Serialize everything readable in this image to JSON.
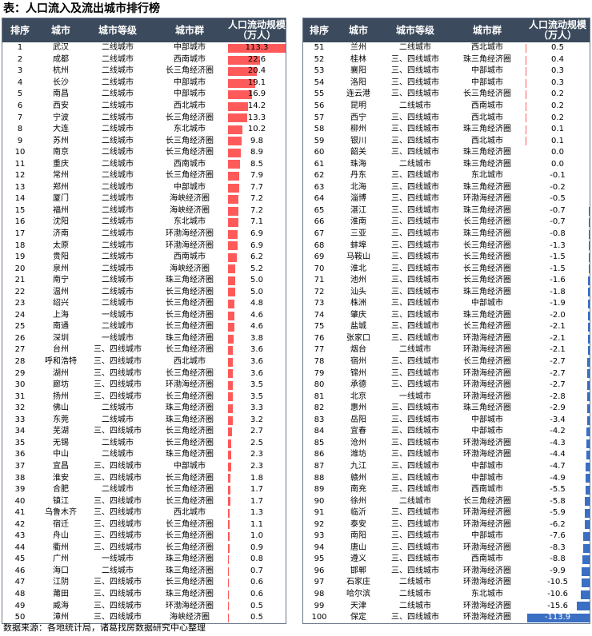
{
  "title": "表：人口流入及流出城市排行榜",
  "source": "数据来源：各地统计局，诸葛找房数据研究中心整理",
  "headers": [
    "排序",
    "城市",
    "城市等级",
    "城市群",
    "人口流动规模\n（万人）"
  ],
  "colors": {
    "header_bg": "#3b4a5c",
    "positive_bar": "#ff5a5a",
    "negative_bar": "#3a6fc4"
  },
  "rows": [
    [
      "1",
      "武汉",
      "二线城市",
      "中部城市",
      "113.3"
    ],
    [
      "2",
      "成都",
      "二线城市",
      "西南城市",
      "22.6"
    ],
    [
      "3",
      "杭州",
      "二线城市",
      "长三角经济圈",
      "20.4"
    ],
    [
      "4",
      "长沙",
      "二线城市",
      "中部城市",
      "19.1"
    ],
    [
      "5",
      "南昌",
      "二线城市",
      "中部城市",
      "16.9"
    ],
    [
      "6",
      "西安",
      "二线城市",
      "西北城市",
      "14.2"
    ],
    [
      "7",
      "宁波",
      "二线城市",
      "长三角经济圈",
      "13.3"
    ],
    [
      "8",
      "大连",
      "二线城市",
      "东北城市",
      "10.2"
    ],
    [
      "9",
      "苏州",
      "二线城市",
      "长三角经济圈",
      "9.8"
    ],
    [
      "10",
      "南京",
      "二线城市",
      "长三角经济圈",
      "8.9"
    ],
    [
      "11",
      "重庆",
      "二线城市",
      "西南城市",
      "8.5"
    ],
    [
      "12",
      "常州",
      "二线城市",
      "长三角经济圈",
      "7.9"
    ],
    [
      "13",
      "郑州",
      "二线城市",
      "中部城市",
      "7.7"
    ],
    [
      "14",
      "厦门",
      "二线城市",
      "海峡经济圈",
      "7.2"
    ],
    [
      "15",
      "福州",
      "二线城市",
      "海峡经济圈",
      "7.2"
    ],
    [
      "16",
      "沈阳",
      "二线城市",
      "东北城市",
      "7.1"
    ],
    [
      "17",
      "济南",
      "二线城市",
      "环渤海经济圈",
      "6.9"
    ],
    [
      "18",
      "太原",
      "二线城市",
      "环渤海经济圈",
      "6.9"
    ],
    [
      "19",
      "贵阳",
      "二线城市",
      "西南城市",
      "6.2"
    ],
    [
      "20",
      "泉州",
      "二线城市",
      "海峡经济圈",
      "5.2"
    ],
    [
      "21",
      "南宁",
      "二线城市",
      "珠三角经济圈",
      "5.0"
    ],
    [
      "22",
      "温州",
      "二线城市",
      "长三角经济圈",
      "5.0"
    ],
    [
      "23",
      "绍兴",
      "二线城市",
      "长三角经济圈",
      "4.8"
    ],
    [
      "24",
      "上海",
      "一线城市",
      "长三角经济圈",
      "4.6"
    ],
    [
      "25",
      "南通",
      "二线城市",
      "长三角经济圈",
      "4.6"
    ],
    [
      "26",
      "深圳",
      "一线城市",
      "珠三角经济圈",
      "3.8"
    ],
    [
      "27",
      "台州",
      "三、四线城市",
      "长三角经济圈",
      "3.6"
    ],
    [
      "28",
      "呼和浩特",
      "三、四线城市",
      "西北城市",
      "3.6"
    ],
    [
      "29",
      "湖州",
      "三、四线城市",
      "长三角经济圈",
      "3.6"
    ],
    [
      "30",
      "廊坊",
      "三、四线城市",
      "环渤海经济圈",
      "3.5"
    ],
    [
      "31",
      "扬州",
      "三、四线城市",
      "长三角经济圈",
      "3.5"
    ],
    [
      "32",
      "佛山",
      "二线城市",
      "珠三角经济圈",
      "3.3"
    ],
    [
      "33",
      "东莞",
      "二线城市",
      "珠三角经济圈",
      "3.2"
    ],
    [
      "34",
      "芜湖",
      "三、四线城市",
      "长三角经济圈",
      "2.7"
    ],
    [
      "35",
      "无锡",
      "二线城市",
      "长三角经济圈",
      "2.5"
    ],
    [
      "36",
      "中山",
      "二线城市",
      "珠三角经济圈",
      "2.3"
    ],
    [
      "37",
      "宜昌",
      "三、四线城市",
      "中部城市",
      "2.3"
    ],
    [
      "38",
      "淮安",
      "三、四线城市",
      "长三角经济圈",
      "1.8"
    ],
    [
      "39",
      "合肥",
      "二线城市",
      "长三角经济圈",
      "1.7"
    ],
    [
      "40",
      "镇江",
      "三、四线城市",
      "长三角经济圈",
      "1.7"
    ],
    [
      "41",
      "乌鲁木齐",
      "三、四线城市",
      "西北城市",
      "1.3"
    ],
    [
      "42",
      "宿迁",
      "三、四线城市",
      "长三角经济圈",
      "1.1"
    ],
    [
      "43",
      "舟山",
      "三、四线城市",
      "长三角经济圈",
      "1.0"
    ],
    [
      "44",
      "衢州",
      "三、四线城市",
      "长三角经济圈",
      "0.9"
    ],
    [
      "45",
      "广州",
      "一线城市",
      "珠三角经济圈",
      "0.8"
    ],
    [
      "46",
      "海口",
      "二线城市",
      "珠三角经济圈",
      "0.7"
    ],
    [
      "47",
      "江阴",
      "三、四线城市",
      "长三角经济圈",
      "0.6"
    ],
    [
      "48",
      "莆田",
      "三、四线城市",
      "珠三角经济圈",
      "0.6"
    ],
    [
      "49",
      "威海",
      "三、四线城市",
      "环渤海经济圈",
      "0.5"
    ],
    [
      "50",
      "漳州",
      "三、四线城市",
      "海峡经济圈",
      "0.5"
    ],
    [
      "51",
      "兰州",
      "二线城市",
      "西北城市",
      "0.5"
    ],
    [
      "52",
      "桂林",
      "三、四线城市",
      "珠三角经济圈",
      "0.4"
    ],
    [
      "53",
      "襄阳",
      "三、四线城市",
      "中部城市",
      "0.3"
    ],
    [
      "54",
      "洛阳",
      "三、四线城市",
      "中部城市",
      "0.3"
    ],
    [
      "55",
      "连云港",
      "三、四线城市",
      "长三角经济圈",
      "0.2"
    ],
    [
      "56",
      "昆明",
      "二线城市",
      "西南城市",
      "0.2"
    ],
    [
      "57",
      "西宁",
      "三、四线城市",
      "西北城市",
      "0.2"
    ],
    [
      "58",
      "柳州",
      "三、四线城市",
      "珠三角经济圈",
      "0.1"
    ],
    [
      "59",
      "银川",
      "三、四线城市",
      "西北城市",
      "0.1"
    ],
    [
      "60",
      "韶关",
      "三、四线城市",
      "珠三角经济圈",
      "0.0"
    ],
    [
      "61",
      "珠海",
      "二线城市",
      "珠三角经济圈",
      "0.0"
    ],
    [
      "62",
      "丹东",
      "三、四线城市",
      "东北城市",
      "-0.1"
    ],
    [
      "63",
      "北海",
      "三、四线城市",
      "珠三角经济圈",
      "-0.2"
    ],
    [
      "64",
      "淄博",
      "三、四线城市",
      "环渤海经济圈",
      "-0.5"
    ],
    [
      "65",
      "湛江",
      "三、四线城市",
      "珠三角经济圈",
      "-0.7"
    ],
    [
      "66",
      "淮南",
      "三、四线城市",
      "长三角经济圈",
      "-0.7"
    ],
    [
      "67",
      "三亚",
      "三、四线城市",
      "珠三角经济圈",
      "-0.8"
    ],
    [
      "68",
      "蚌埠",
      "三、四线城市",
      "长三角经济圈",
      "-1.3"
    ],
    [
      "69",
      "马鞍山",
      "三、四线城市",
      "长三角经济圈",
      "-1.5"
    ],
    [
      "70",
      "淮北",
      "三、四线城市",
      "长三角经济圈",
      "-1.5"
    ],
    [
      "71",
      "池州",
      "三、四线城市",
      "长三角经济圈",
      "-1.6"
    ],
    [
      "72",
      "汕头",
      "三、四线城市",
      "珠三角经济圈",
      "-1.8"
    ],
    [
      "73",
      "株洲",
      "三、四线城市",
      "中部城市",
      "-1.9"
    ],
    [
      "74",
      "肇庆",
      "三、四线城市",
      "珠三角经济圈",
      "-2.0"
    ],
    [
      "75",
      "盐城",
      "三、四线城市",
      "长三角经济圈",
      "-2.1"
    ],
    [
      "76",
      "张家口",
      "三、四线城市",
      "环渤海经济圈",
      "-2.1"
    ],
    [
      "77",
      "烟台",
      "二线城市",
      "环渤海经济圈",
      "-2.1"
    ],
    [
      "78",
      "宿州",
      "三、四线城市",
      "长三角经济圈",
      "-2.7"
    ],
    [
      "79",
      "锦州",
      "三、四线城市",
      "环渤海经济圈",
      "-2.7"
    ],
    [
      "80",
      "承德",
      "三、四线城市",
      "环渤海经济圈",
      "-2.7"
    ],
    [
      "81",
      "北京",
      "一线城市",
      "环渤海经济圈",
      "-2.8"
    ],
    [
      "82",
      "惠州",
      "三、四线城市",
      "珠三角经济圈",
      "-2.9"
    ],
    [
      "83",
      "岳阳",
      "三、四线城市",
      "中部城市",
      "-3.4"
    ],
    [
      "84",
      "宜春",
      "三、四线城市",
      "中部城市",
      "-4.2"
    ],
    [
      "85",
      "沧州",
      "三、四线城市",
      "环渤海经济圈",
      "-4.3"
    ],
    [
      "86",
      "潍坊",
      "三、四线城市",
      "环渤海经济圈",
      "-4.4"
    ],
    [
      "87",
      "九江",
      "三、四线城市",
      "中部城市",
      "-4.7"
    ],
    [
      "88",
      "赣州",
      "三、四线城市",
      "中部城市",
      "-4.9"
    ],
    [
      "89",
      "南充",
      "三、四线城市",
      "西南城市",
      "-5.5"
    ],
    [
      "90",
      "徐州",
      "二线城市",
      "长三角经济圈",
      "-5.8"
    ],
    [
      "91",
      "临沂",
      "三、四线城市",
      "环渤海经济圈",
      "-5.9"
    ],
    [
      "92",
      "泰安",
      "三、四线城市",
      "环渤海经济圈",
      "-6.2"
    ],
    [
      "93",
      "南阳",
      "三、四线城市",
      "中部城市",
      "-7.6"
    ],
    [
      "94",
      "唐山",
      "三、四线城市",
      "环渤海经济圈",
      "-8.3"
    ],
    [
      "95",
      "遵义",
      "三、四线城市",
      "西南城市",
      "-8.8"
    ],
    [
      "96",
      "邯郸",
      "三、四线城市",
      "环渤海经济圈",
      "-9.9"
    ],
    [
      "97",
      "石家庄",
      "二线城市",
      "环渤海经济圈",
      "-10.5"
    ],
    [
      "98",
      "哈尔滨",
      "二线城市",
      "东北城市",
      "-10.6"
    ],
    [
      "99",
      "天津",
      "二线城市",
      "环渤海经济圈",
      "-15.6"
    ],
    [
      "100",
      "保定",
      "三、四线城市",
      "环渤海经济圈",
      "-113.9"
    ]
  ]
}
